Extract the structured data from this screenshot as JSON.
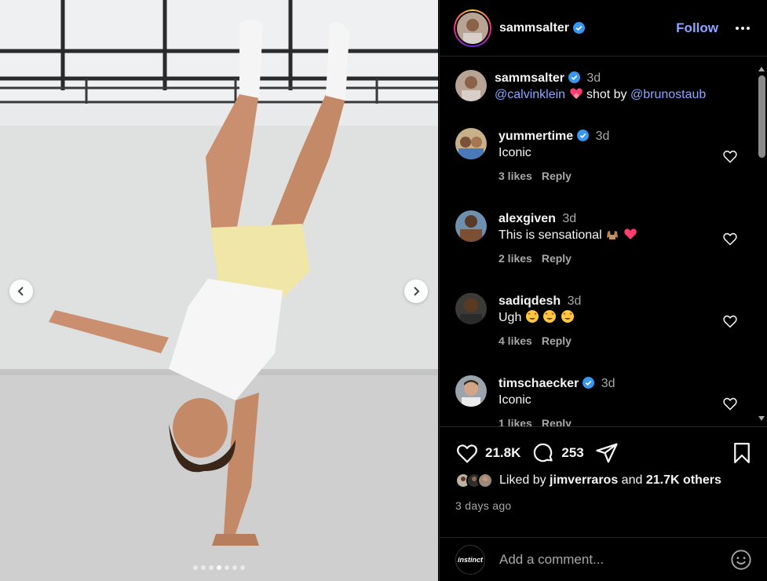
{
  "post": {
    "author": "sammsalter",
    "follow_label": "Follow",
    "caption": {
      "username": "sammsalter",
      "time": "3d",
      "mention1": "@calvinklein",
      "middle": "shot by",
      "mention2": "@brunostaub"
    },
    "carousel": {
      "total": 7,
      "active_index": 3
    }
  },
  "comments": [
    {
      "username": "yummertime",
      "verified": true,
      "time": "3d",
      "text": "Iconic",
      "likes": "3 likes",
      "reply": "Reply"
    },
    {
      "username": "alexgiven",
      "verified": false,
      "time": "3d",
      "text": "This is sensational",
      "likes": "2 likes",
      "reply": "Reply"
    },
    {
      "username": "sadiqdesh",
      "verified": false,
      "time": "3d",
      "text": "Ugh",
      "likes": "4 likes",
      "reply": "Reply"
    },
    {
      "username": "timschaecker",
      "verified": true,
      "time": "3d",
      "text": "Iconic",
      "likes": "1 likes",
      "reply": "Reply"
    }
  ],
  "stats": {
    "likes": "21.8K",
    "comments": "253",
    "liked_by_prefix": "Liked by",
    "liked_by_user": "jimverraros",
    "liked_by_and": "and",
    "liked_by_others": "21.7K others",
    "date": "3 days ago"
  },
  "composer": {
    "avatar_label": "instinct",
    "placeholder": "Add a comment..."
  },
  "colors": {
    "accent": "#8ea6ff",
    "verified": "#3897f0",
    "background": "#000000",
    "muted": "#a8a8a8"
  }
}
